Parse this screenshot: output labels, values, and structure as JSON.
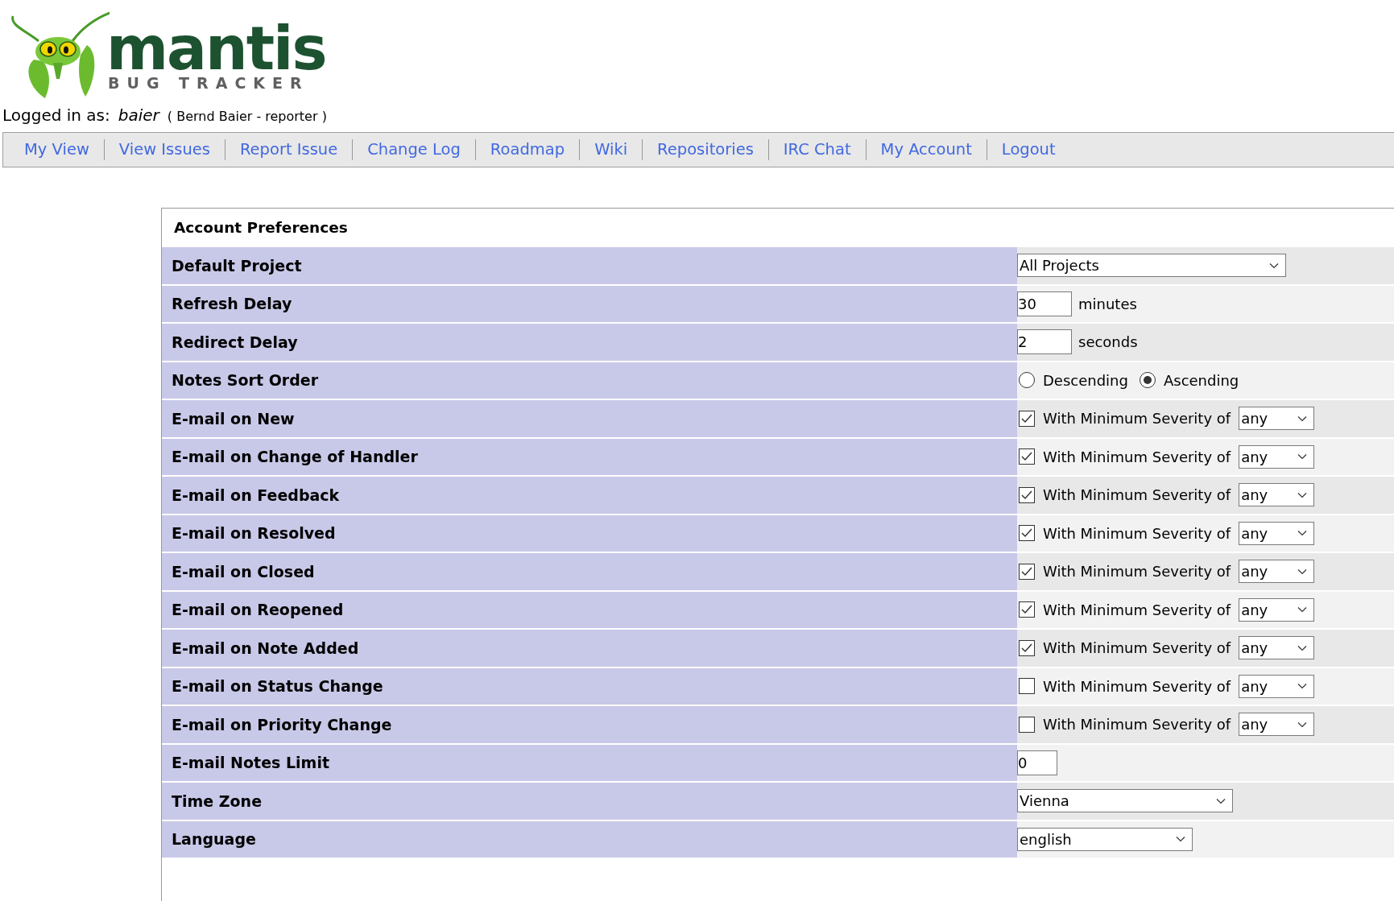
{
  "logo": {
    "word": "mantis",
    "tagline": "BUG TRACKER"
  },
  "login": {
    "prefix": "Logged in as:",
    "username": "baier",
    "details": "( Bernd Baier - reporter )"
  },
  "nav": [
    "My View",
    "View Issues",
    "Report Issue",
    "Change Log",
    "Roadmap",
    "Wiki",
    "Repositories",
    "IRC Chat",
    "My Account",
    "Logout"
  ],
  "panel": {
    "title": "Account Preferences",
    "rows": [
      {
        "label": "Default Project",
        "kind": "select",
        "value": "All Projects"
      },
      {
        "label": "Refresh Delay",
        "kind": "text",
        "value": "30",
        "unit": "minutes"
      },
      {
        "label": "Redirect Delay",
        "kind": "text",
        "value": "2",
        "unit": "seconds"
      },
      {
        "label": "Notes Sort Order",
        "kind": "radio",
        "options": [
          {
            "label": "Descending",
            "selected": false
          },
          {
            "label": "Ascending",
            "selected": true
          }
        ]
      },
      {
        "label": "E-mail on New",
        "kind": "email",
        "checked": true,
        "text": "With Minimum Severity of",
        "severity": "any"
      },
      {
        "label": "E-mail on Change of Handler",
        "kind": "email",
        "checked": true,
        "text": "With Minimum Severity of",
        "severity": "any"
      },
      {
        "label": "E-mail on Feedback",
        "kind": "email",
        "checked": true,
        "text": "With Minimum Severity of",
        "severity": "any"
      },
      {
        "label": "E-mail on Resolved",
        "kind": "email",
        "checked": true,
        "text": "With Minimum Severity of",
        "severity": "any"
      },
      {
        "label": "E-mail on Closed",
        "kind": "email",
        "checked": true,
        "text": "With Minimum Severity of",
        "severity": "any"
      },
      {
        "label": "E-mail on Reopened",
        "kind": "email",
        "checked": true,
        "text": "With Minimum Severity of",
        "severity": "any"
      },
      {
        "label": "E-mail on Note Added",
        "kind": "email",
        "checked": true,
        "text": "With Minimum Severity of",
        "severity": "any"
      },
      {
        "label": "E-mail on Status Change",
        "kind": "email",
        "checked": false,
        "text": "With Minimum Severity of",
        "severity": "any"
      },
      {
        "label": "E-mail on Priority Change",
        "kind": "email",
        "checked": false,
        "text": "With Minimum Severity of",
        "severity": "any"
      },
      {
        "label": "E-mail Notes Limit",
        "kind": "text",
        "value": "0"
      },
      {
        "label": "Time Zone",
        "kind": "select",
        "value": "Vienna"
      },
      {
        "label": "Language",
        "kind": "select",
        "value": "english"
      }
    ]
  }
}
